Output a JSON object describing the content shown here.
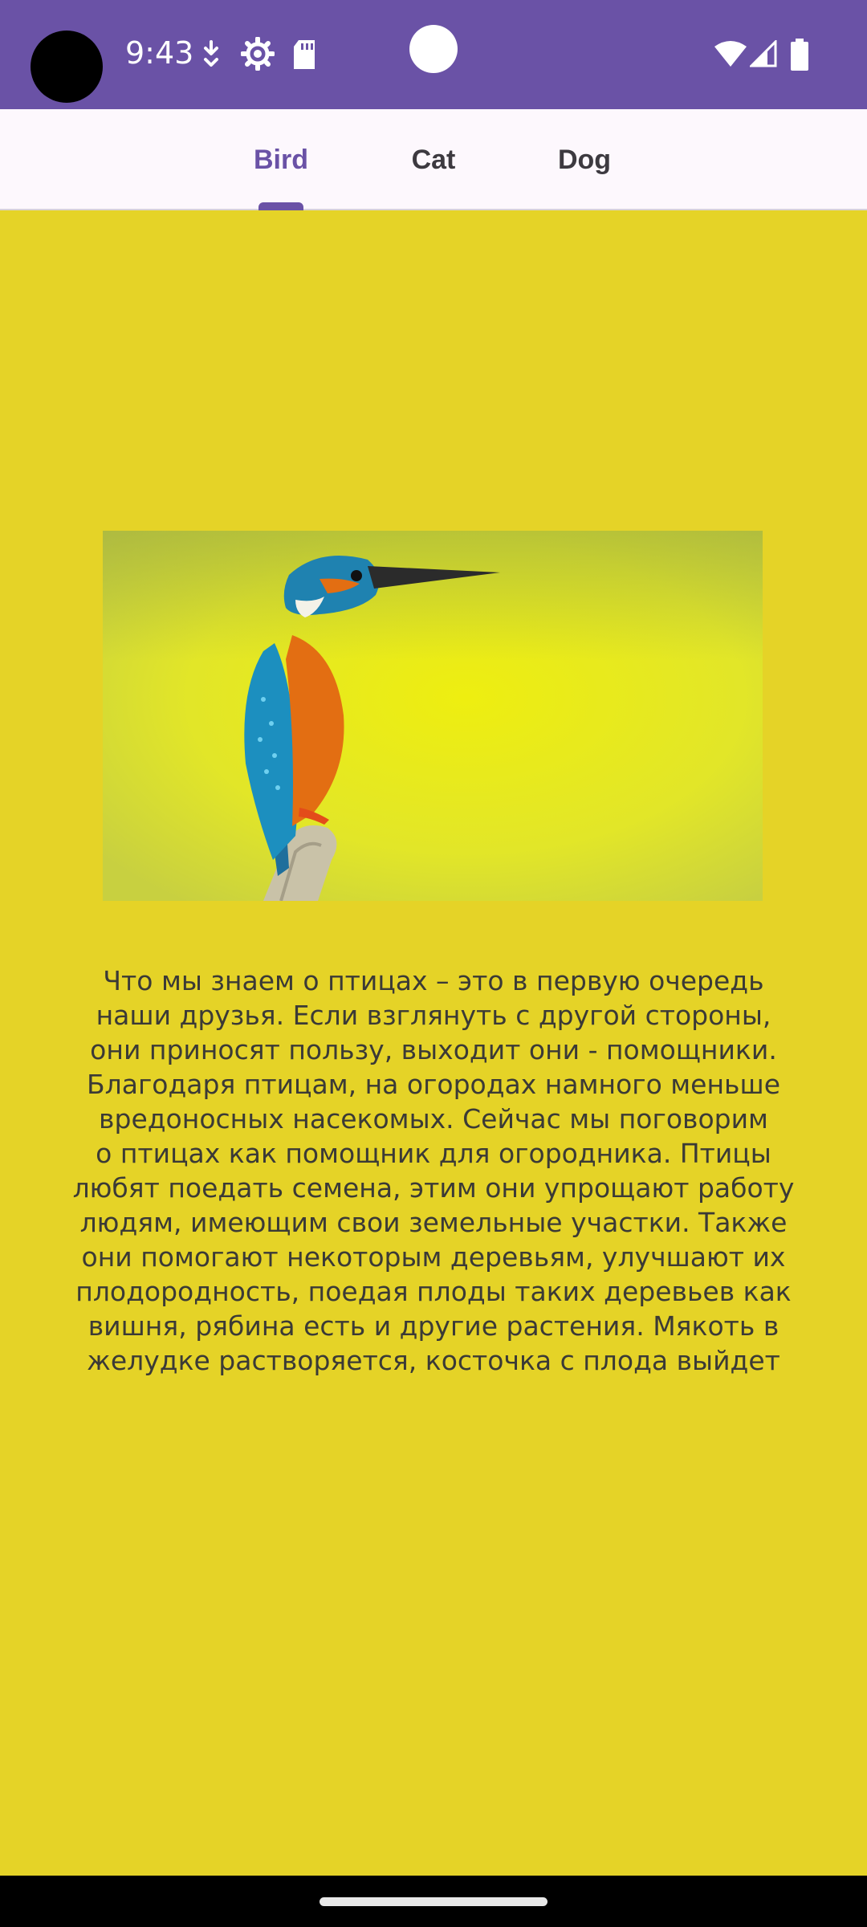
{
  "status_bar": {
    "time": "9:43",
    "icons_left": [
      "download-icon",
      "settings-icon",
      "sd-card-icon"
    ],
    "icons_right": [
      "wifi-icon",
      "signal-icon",
      "battery-icon"
    ],
    "background": "#6a52a6"
  },
  "tabs": [
    {
      "label": "Bird",
      "selected": true
    },
    {
      "label": "Cat",
      "selected": false
    },
    {
      "label": "Dog",
      "selected": false
    }
  ],
  "accent_color": "#6a52a6",
  "background_color": "#e5d327",
  "content": {
    "image_subject": "kingfisher-bird",
    "description_lines": [
      "Что мы знаем о птицах – это в первую очередь",
      "наши друзья. Если взглянуть с другой стороны,",
      "они приносят пользу, выходит они - помощники.",
      "Благодаря птицам, на огородах намного меньше",
      "вредоносных насекомых. Сейчас мы поговорим",
      "о птицах как помощник для огородника. Птицы",
      "любят поедать семена, этим они упрощают работу",
      "людям, имеющим свои земельные участки. Также",
      "они помогают некоторым деревьям, улучшают их",
      "плодородность, поедая плоды таких деревьев как",
      "вишня, рябина есть и другие растения. Мякоть в",
      "желудке растворяется, косточка с плода выйдет"
    ]
  }
}
